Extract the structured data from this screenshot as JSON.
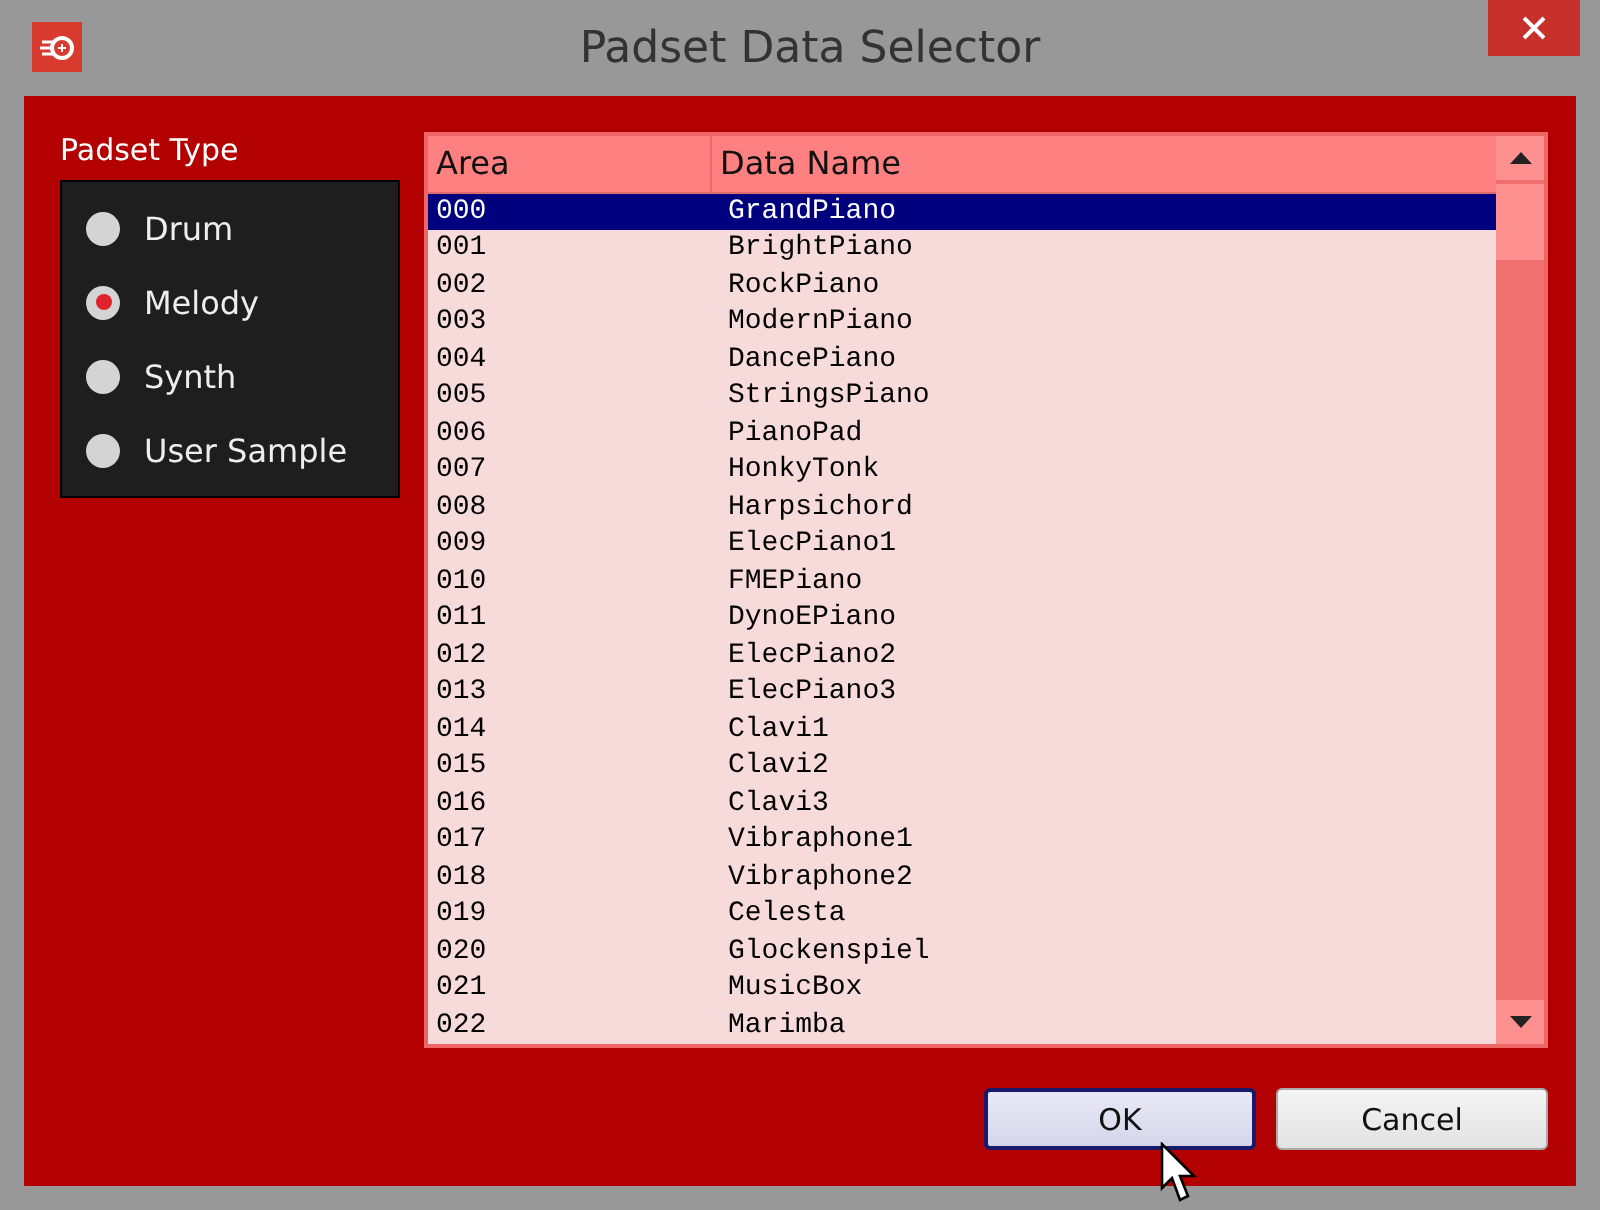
{
  "window": {
    "title": "Padset Data Selector"
  },
  "padset_type": {
    "label": "Padset Type",
    "options": [
      {
        "label": "Drum",
        "selected": false
      },
      {
        "label": "Melody",
        "selected": true
      },
      {
        "label": "Synth",
        "selected": false
      },
      {
        "label": "User Sample",
        "selected": false
      }
    ]
  },
  "table": {
    "columns": [
      "Area",
      "Data Name"
    ],
    "rows": [
      {
        "cells": [
          "000",
          "GrandPiano"
        ],
        "selected": true
      },
      {
        "cells": [
          "001",
          "BrightPiano"
        ],
        "selected": false
      },
      {
        "cells": [
          "002",
          "RockPiano"
        ],
        "selected": false
      },
      {
        "cells": [
          "003",
          "ModernPiano"
        ],
        "selected": false
      },
      {
        "cells": [
          "004",
          "DancePiano"
        ],
        "selected": false
      },
      {
        "cells": [
          "005",
          "StringsPiano"
        ],
        "selected": false
      },
      {
        "cells": [
          "006",
          "PianoPad"
        ],
        "selected": false
      },
      {
        "cells": [
          "007",
          "HonkyTonk"
        ],
        "selected": false
      },
      {
        "cells": [
          "008",
          "Harpsichord"
        ],
        "selected": false
      },
      {
        "cells": [
          "009",
          "ElecPiano1"
        ],
        "selected": false
      },
      {
        "cells": [
          "010",
          "FMEPiano"
        ],
        "selected": false
      },
      {
        "cells": [
          "011",
          "DynoEPiano"
        ],
        "selected": false
      },
      {
        "cells": [
          "012",
          "ElecPiano2"
        ],
        "selected": false
      },
      {
        "cells": [
          "013",
          "ElecPiano3"
        ],
        "selected": false
      },
      {
        "cells": [
          "014",
          "Clavi1"
        ],
        "selected": false
      },
      {
        "cells": [
          "015",
          "Clavi2"
        ],
        "selected": false
      },
      {
        "cells": [
          "016",
          "Clavi3"
        ],
        "selected": false
      },
      {
        "cells": [
          "017",
          "Vibraphone1"
        ],
        "selected": false
      },
      {
        "cells": [
          "018",
          "Vibraphone2"
        ],
        "selected": false
      },
      {
        "cells": [
          "019",
          "Celesta"
        ],
        "selected": false
      },
      {
        "cells": [
          "020",
          "Glockenspiel"
        ],
        "selected": false
      },
      {
        "cells": [
          "021",
          "MusicBox"
        ],
        "selected": false
      },
      {
        "cells": [
          "022",
          "Marimba"
        ],
        "selected": false
      }
    ]
  },
  "buttons": [
    {
      "label": "OK",
      "kind": "default"
    },
    {
      "label": "Cancel",
      "kind": "normal"
    }
  ]
}
